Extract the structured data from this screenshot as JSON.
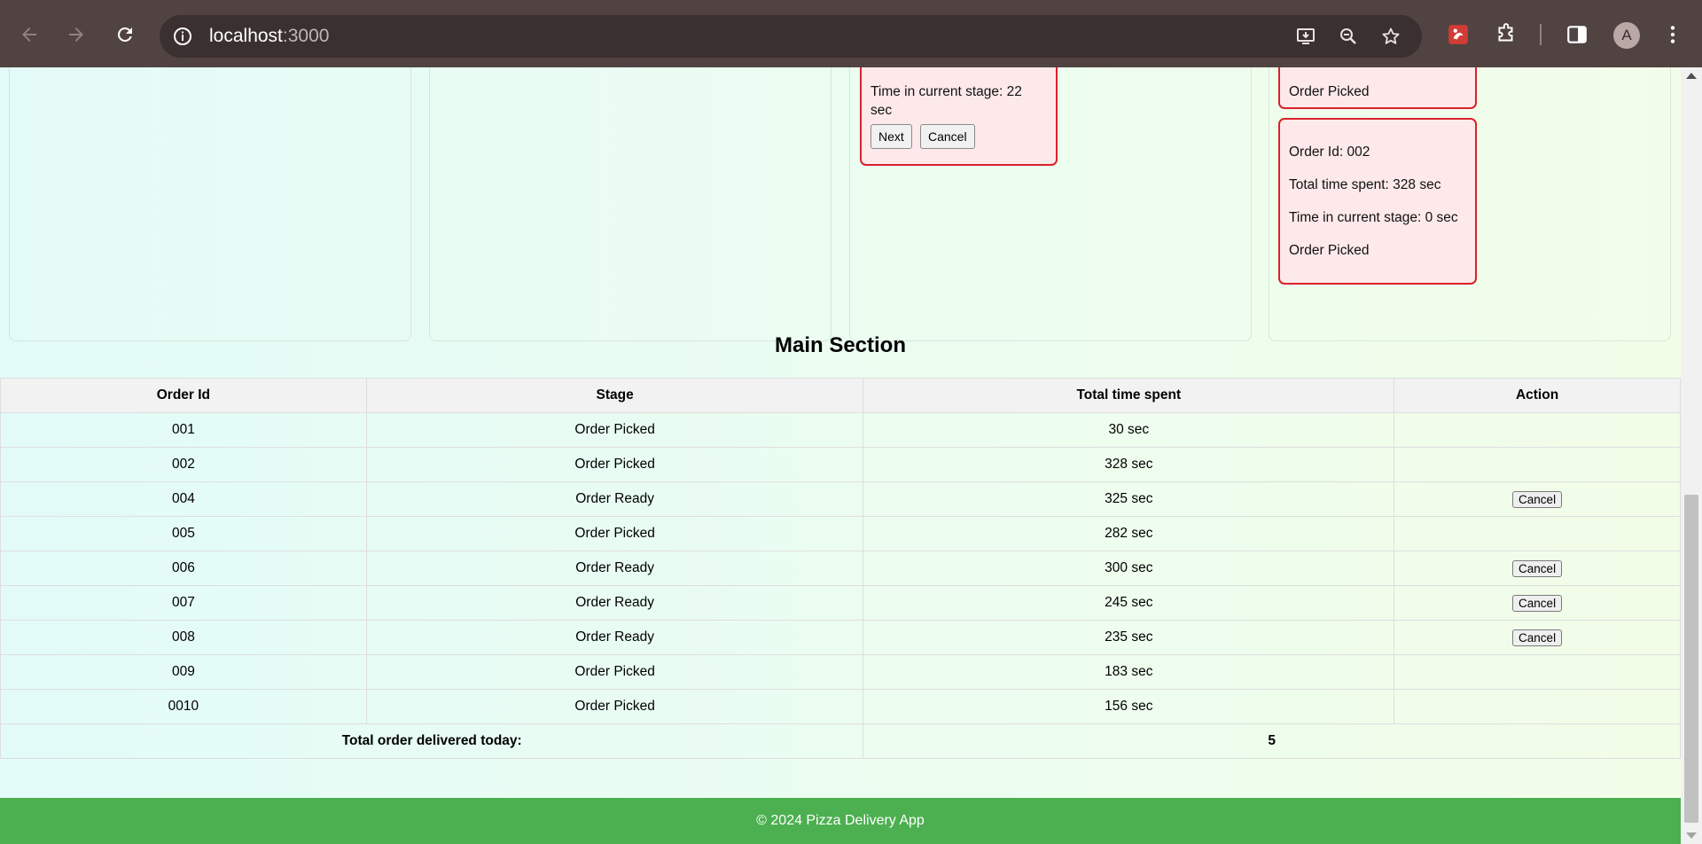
{
  "browser": {
    "url_host": "localhost",
    "url_port": ":3000",
    "avatar_letter": "A"
  },
  "stages": {
    "column3_card": {
      "time_current": "Time in current stage: 22",
      "time_current_unit": "sec",
      "next_label": "Next",
      "cancel_label": "Cancel"
    },
    "column4_cards": [
      {
        "stage": "Order Picked"
      },
      {
        "order_id": "Order Id: 002",
        "total_time": "Total time spent: 328 sec",
        "time_current": "Time in current stage: 0 sec",
        "stage": "Order Picked"
      }
    ]
  },
  "main": {
    "title": "Main Section",
    "columns": [
      "Order Id",
      "Stage",
      "Total time spent",
      "Action"
    ],
    "rows": [
      {
        "id": "001",
        "stage": "Order Picked",
        "time": "30 sec",
        "action": ""
      },
      {
        "id": "002",
        "stage": "Order Picked",
        "time": "328 sec",
        "action": ""
      },
      {
        "id": "004",
        "stage": "Order Ready",
        "time": "325 sec",
        "action": "Cancel"
      },
      {
        "id": "005",
        "stage": "Order Picked",
        "time": "282 sec",
        "action": ""
      },
      {
        "id": "006",
        "stage": "Order Ready",
        "time": "300 sec",
        "action": "Cancel"
      },
      {
        "id": "007",
        "stage": "Order Ready",
        "time": "245 sec",
        "action": "Cancel"
      },
      {
        "id": "008",
        "stage": "Order Ready",
        "time": "235 sec",
        "action": "Cancel"
      },
      {
        "id": "009",
        "stage": "Order Picked",
        "time": "183 sec",
        "action": ""
      },
      {
        "id": "0010",
        "stage": "Order Picked",
        "time": "156 sec",
        "action": ""
      }
    ],
    "total_label": "Total order delivered today:",
    "total_value": "5"
  },
  "footer": {
    "text": "© 2024 Pizza Delivery App"
  },
  "colors": {
    "card_border": "#d8222c",
    "card_bg": "#fde9ea",
    "footer_bg": "#4caf50",
    "chrome_bg": "#514341"
  }
}
